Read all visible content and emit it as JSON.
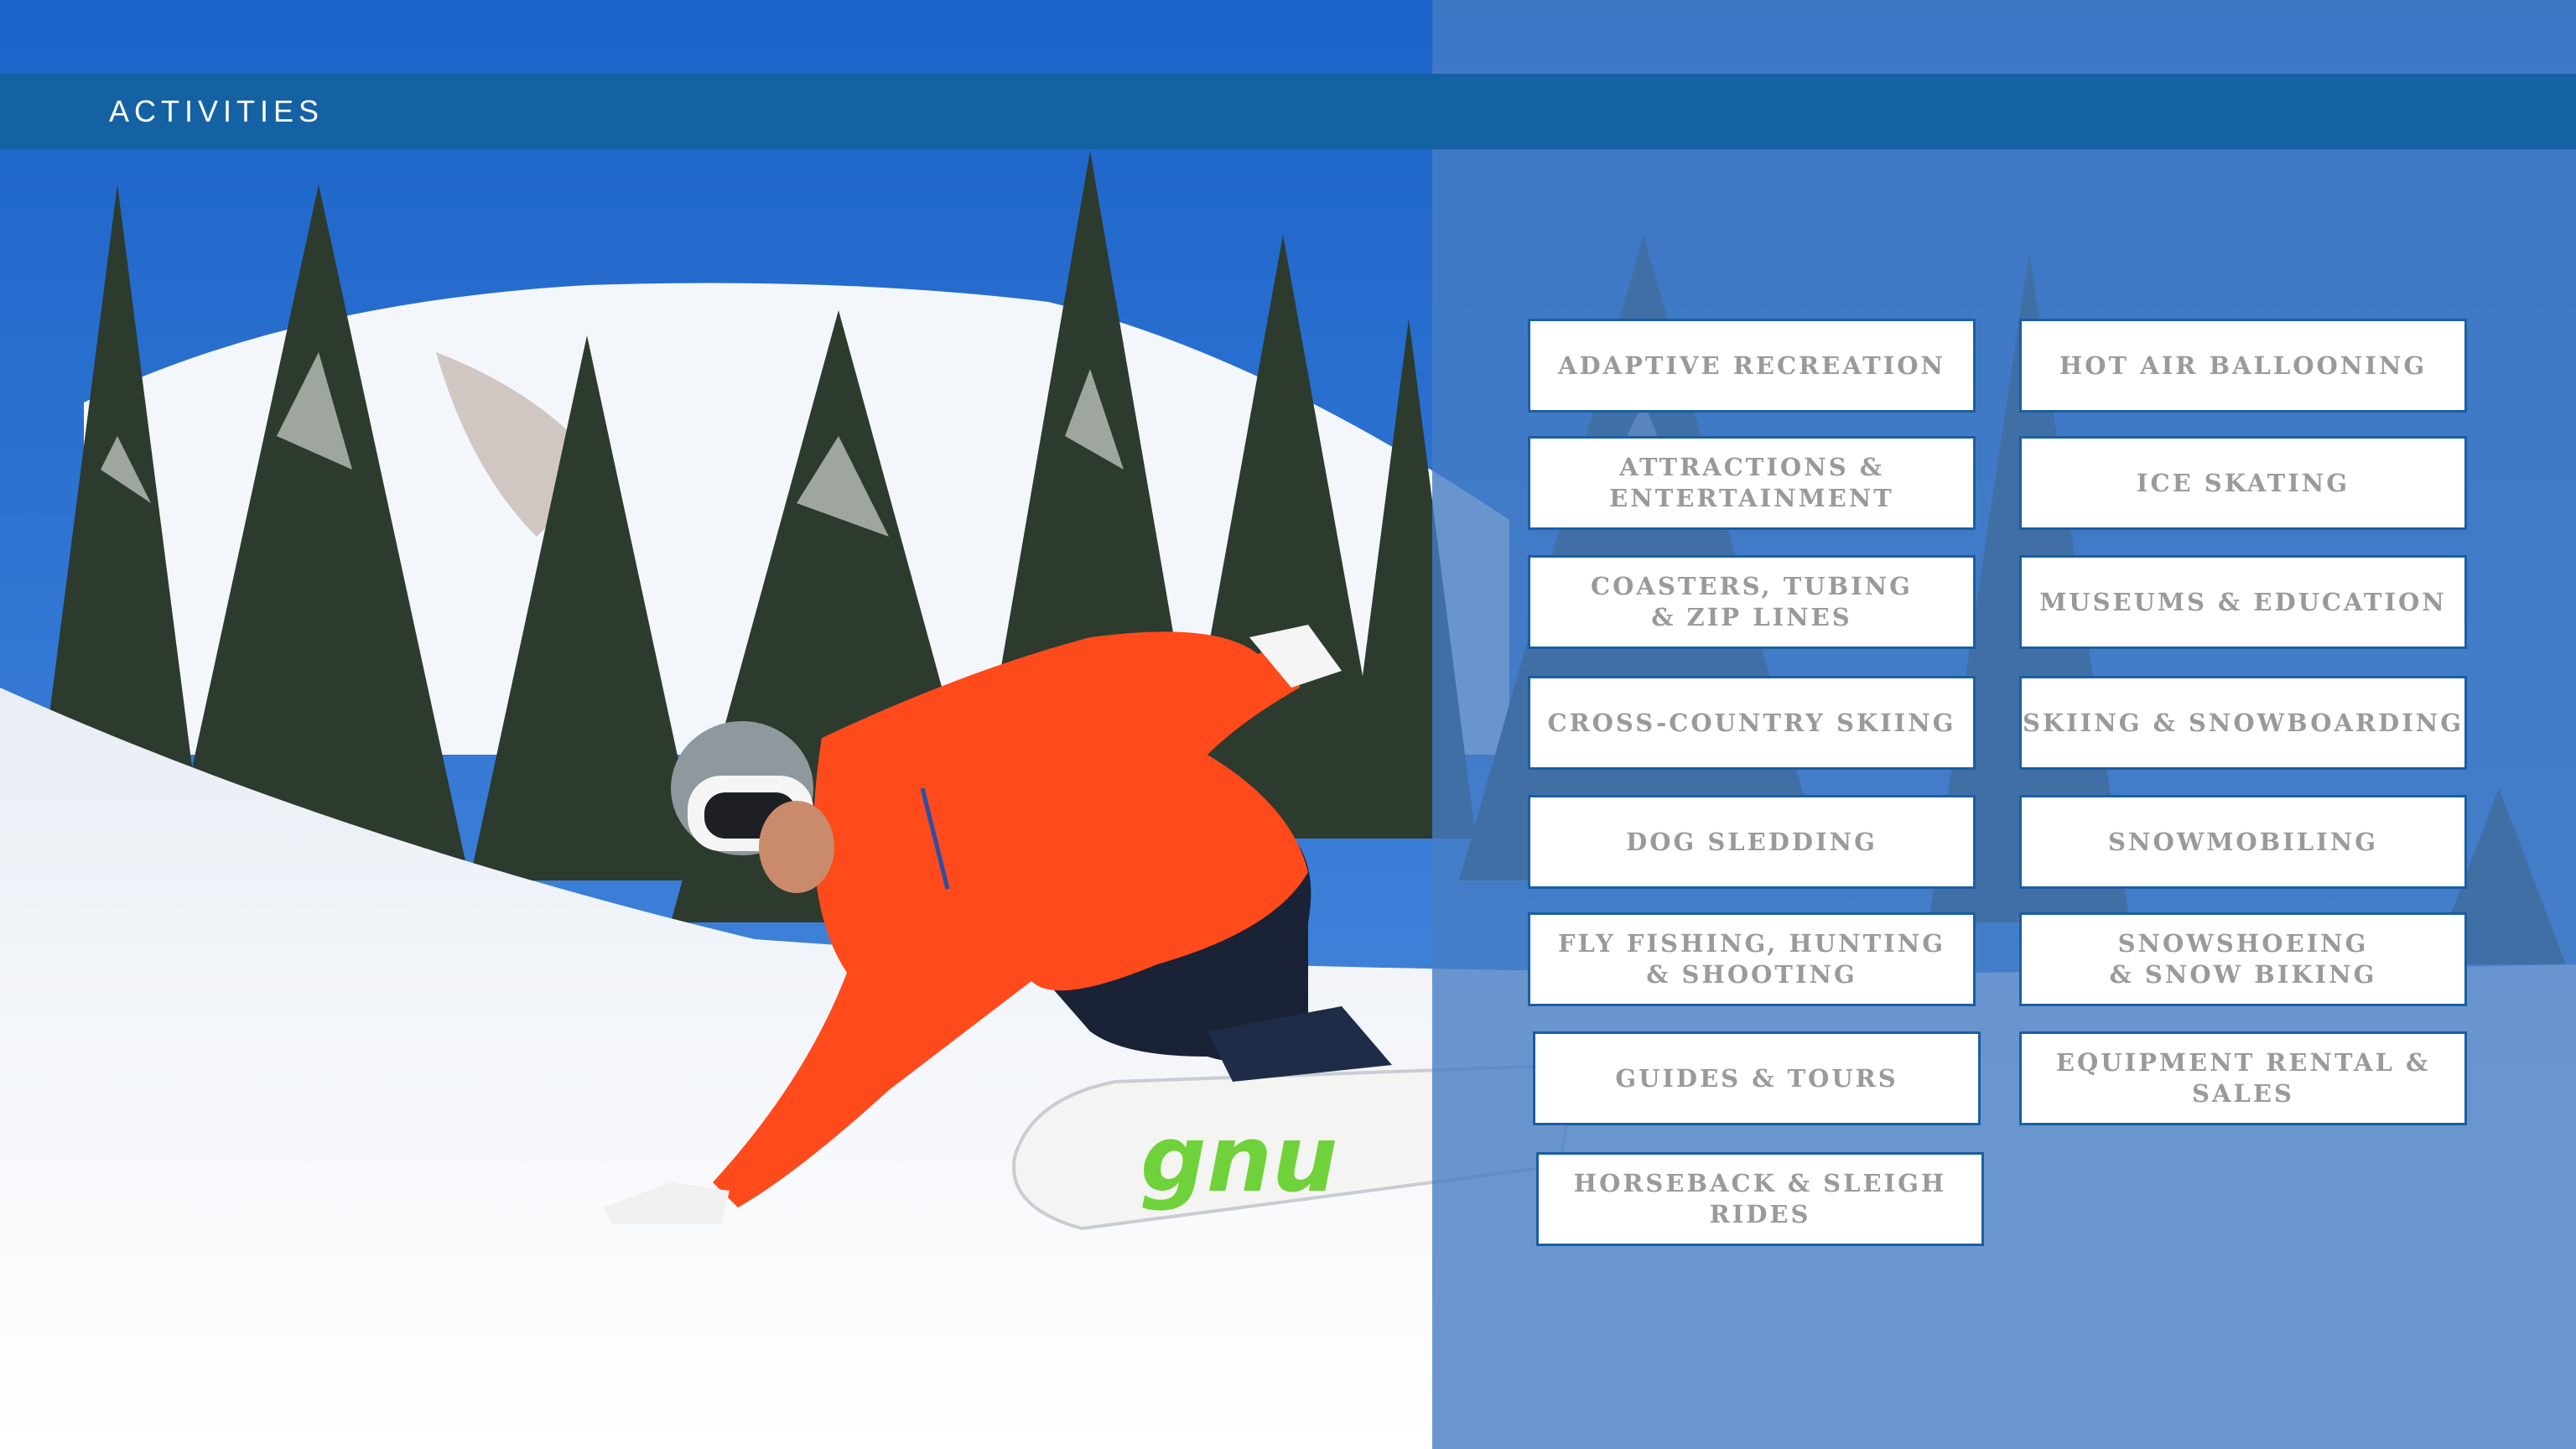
{
  "header": {
    "title": "ACTIVITIES"
  },
  "activities": {
    "left": [
      "ADAPTIVE RECREATION",
      "ATTRACTIONS &\nENTERTAINMENT",
      "COASTERS, TUBING\n& ZIP LINES",
      "CROSS-COUNTRY SKIING",
      "DOG SLEDDING",
      "FLY FISHING, HUNTING\n& SHOOTING",
      "GUIDES & TOURS",
      "HORSEBACK & SLEIGH\nRIDES"
    ],
    "right": [
      "HOT AIR BALLOONING",
      "ICE SKATING",
      "MUSEUMS & EDUCATION",
      "SKIING & SNOWBOARDING",
      "SNOWMOBILING",
      "SNOWSHOEING\n& SNOW BIKING",
      "EQUIPMENT RENTAL &\nSALES"
    ]
  },
  "colors": {
    "header_bar": "#1462a3",
    "overlay": "#467dc4",
    "button_border": "#1a5ea3",
    "button_text": "#9a9a9a",
    "jacket": "#ff4a1c"
  },
  "image": {
    "subject": "snowboarder-carving-photo"
  }
}
